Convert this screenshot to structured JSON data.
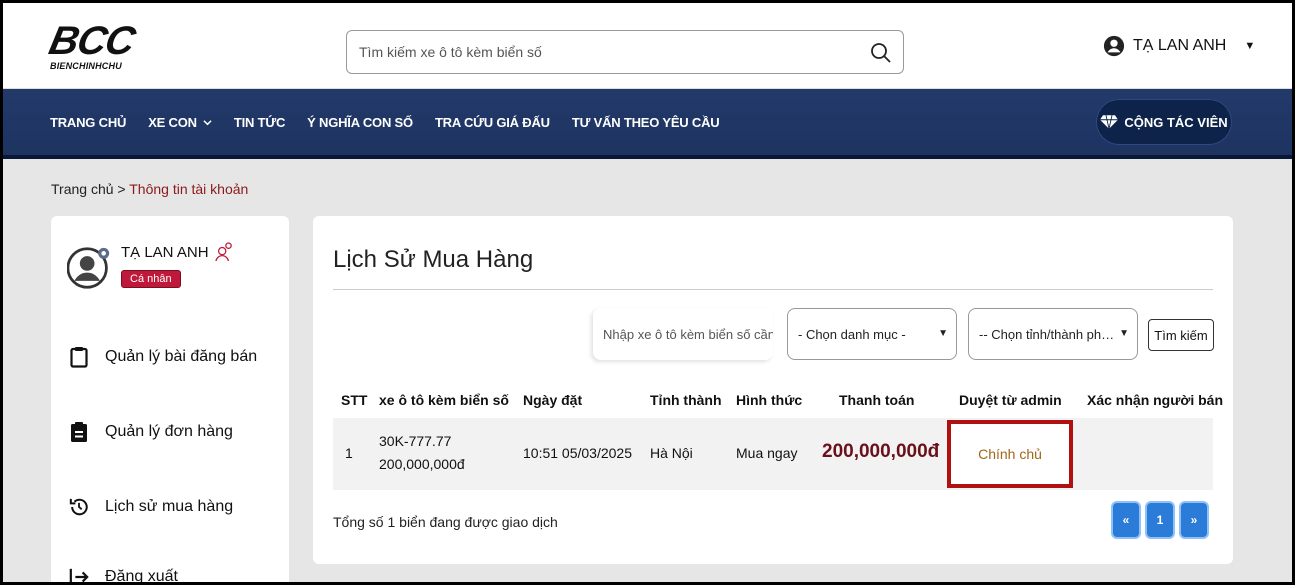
{
  "header": {
    "logo_text": "BCC",
    "logo_subtext": "BIENCHINHCHU",
    "search_placeholder": "Tìm kiếm xe ô tô kèm biển số",
    "user_name": "TẠ LAN ANH"
  },
  "nav": {
    "items": [
      {
        "label": "TRANG CHỦ"
      },
      {
        "label": "XE CON",
        "has_dropdown": true
      },
      {
        "label": "TIN TỨC"
      },
      {
        "label": "Ý NGHĨA CON SỐ"
      },
      {
        "label": "TRA CỨU GIÁ ĐẤU"
      },
      {
        "label": "TƯ VẤN THEO YÊU CẦU"
      }
    ],
    "ctv_label": "CỘNG TÁC VIÊN"
  },
  "breadcrumb": {
    "home": "Trang chủ",
    "separator": ">",
    "current": "Thông tin tài khoản"
  },
  "sidebar": {
    "user_name": "TẠ LAN ANH",
    "badge": "Cá nhân",
    "items": [
      {
        "label": "Quản lý bài đăng bán",
        "icon": "clipboard-icon"
      },
      {
        "label": "Quản lý đơn hàng",
        "icon": "order-icon"
      },
      {
        "label": "Lịch sử mua hàng",
        "icon": "history-icon"
      },
      {
        "label": "Đăng xuất",
        "icon": "logout-icon"
      }
    ]
  },
  "main": {
    "title": "Lịch Sử Mua Hàng",
    "filter": {
      "input_placeholder": "Nhập xe ô tô kèm biển số cần tìm",
      "category_selected": "- Chọn danh mục -",
      "province_selected": "-- Chọn tỉnh/thành phố --",
      "search_button": "Tìm kiếm"
    },
    "table": {
      "headers": [
        "STT",
        "xe ô tô kèm biển số",
        "Ngày đặt",
        "Tỉnh thành",
        "Hình thức",
        "Thanh toán",
        "Duyệt từ admin",
        "Xác nhận người bán"
      ],
      "rows": [
        {
          "stt": "1",
          "plate": "30K-777.77",
          "plate_price": "200,000,000đ",
          "date": "10:51 05/03/2025",
          "province": "Hà Nội",
          "method": "Mua ngay",
          "payment": "200,000,000đ",
          "admin_status": "Chính chủ",
          "seller_confirm": ""
        }
      ]
    },
    "total_text": "Tổng số 1 biển đang được giao dịch",
    "pagination": {
      "prev": "«",
      "current": "1",
      "next": "»"
    }
  },
  "colors": {
    "nav_bg": "#1e3360",
    "badge_bg": "#c0183a",
    "price": "#6b0f1a",
    "highlight_border": "#b01010",
    "pager_bg": "#2b7bd9"
  }
}
